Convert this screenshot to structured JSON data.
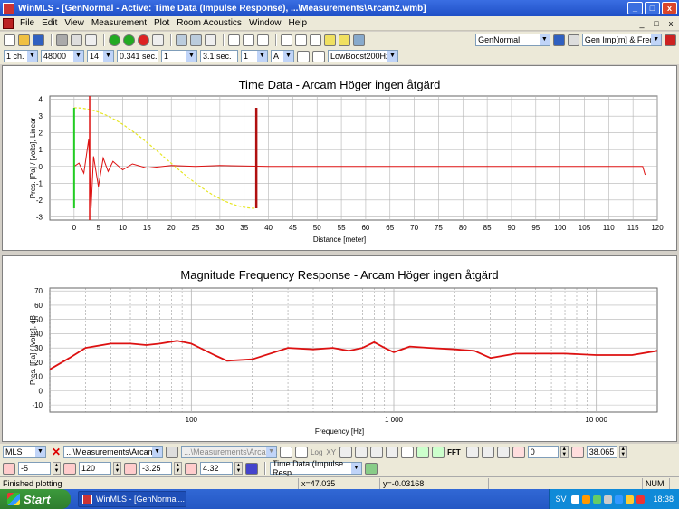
{
  "window": {
    "title": "WinMLS - [GenNormal - Active: Time Data (Impulse Response), ...\\Measurements\\Arcam2.wmb]",
    "min_label": "_",
    "max_label": "□",
    "close_label": "x"
  },
  "menu": [
    "File",
    "Edit",
    "View",
    "Measurement",
    "Plot",
    "Room Acoustics",
    "Window",
    "Help"
  ],
  "mdi_controls": [
    "_",
    "□",
    "x"
  ],
  "toolbar1": {
    "preset": "GenNormal",
    "graph_select": "Gen Imp[m] & Freq"
  },
  "toolbar2": {
    "channels": "1 ch.",
    "sample_rate": "48000",
    "order": "14",
    "length": "0.341 sec.",
    "averages": "1",
    "pre_delay": "3.1 sec.",
    "input": "1",
    "mode": "A",
    "filter": "LowBoost200HzS"
  },
  "colors": {
    "trace": "#dd1111",
    "window": "#e6e620",
    "green_marker": "#22cc22",
    "grid": "#b4b4b4"
  },
  "charts": [
    {
      "title": "Time Data - Arcam Höger ingen åtgärd",
      "ylabel": "Pres. [Pa] / [volts], Linear",
      "xlabel": "Distance [meter]",
      "xticks": [
        "0",
        "5",
        "10",
        "15",
        "20",
        "25",
        "30",
        "35",
        "40",
        "45",
        "50",
        "55",
        "60",
        "65",
        "70",
        "75",
        "80",
        "85",
        "90",
        "95",
        "100",
        "105",
        "110",
        "115",
        "120"
      ],
      "yticks": [
        "4",
        "3",
        "2",
        "1",
        "0",
        "-1",
        "-2",
        "-3"
      ]
    },
    {
      "title": "Magnitude Frequency Response - Arcam Höger ingen åtgärd",
      "ylabel": "Pres. [Pa] / [volts], dB",
      "xlabel": "Frequency [Hz]",
      "xticks": [
        "100",
        "1 000",
        "10 000"
      ],
      "yticks": [
        "70",
        "60",
        "50",
        "40",
        "30",
        "20",
        "10",
        "0",
        "-10"
      ]
    }
  ],
  "chart_data": [
    {
      "type": "line",
      "title": "Time Data - Arcam Höger ingen åtgärd",
      "xlabel": "Distance [meter]",
      "ylabel": "Pres. [Pa] / [volts], Linear",
      "xlim": [
        -5,
        120
      ],
      "ylim": [
        -3.2,
        4.2
      ],
      "grid": true,
      "markers_x": [
        0,
        3.2,
        37.5
      ],
      "x": [
        0,
        1,
        2,
        3,
        3.5,
        4,
        5,
        6,
        7,
        8,
        10,
        12,
        15,
        20,
        25,
        30,
        40,
        50,
        60,
        70,
        80,
        90,
        100,
        110,
        117,
        117.5
      ],
      "y": [
        0,
        0.2,
        -0.4,
        1.6,
        -2.5,
        0.6,
        -1.2,
        0.5,
        -0.3,
        0.3,
        -0.2,
        0.15,
        -0.1,
        0.05,
        0,
        0.05,
        0,
        0,
        0,
        0,
        0,
        0,
        0,
        0,
        0,
        -0.5
      ]
    },
    {
      "type": "line",
      "title": "Magnitude Frequency Response - Arcam Höger ingen åtgärd",
      "xlabel": "Frequency [Hz]",
      "ylabel": "Pres. [Pa] / [volts], dB",
      "xscale": "log",
      "xlim": [
        20,
        20000
      ],
      "ylim": [
        -15,
        72
      ],
      "grid": true,
      "x": [
        20,
        25,
        30,
        40,
        50,
        60,
        70,
        85,
        100,
        130,
        150,
        200,
        300,
        400,
        500,
        600,
        700,
        800,
        900,
        1000,
        1200,
        1500,
        2000,
        2500,
        3000,
        4000,
        5000,
        7000,
        10000,
        15000,
        20000
      ],
      "y": [
        15,
        23,
        30,
        33,
        33,
        32,
        33,
        35,
        33,
        25,
        21,
        22,
        30,
        29,
        30,
        28,
        30,
        34,
        30,
        27,
        31,
        30,
        29,
        28,
        23,
        26,
        26,
        26,
        25,
        25,
        28
      ]
    }
  ],
  "bottom1": {
    "type": "MLS",
    "file_a": "...\\Measurements\\Arcam2",
    "file_b": "...\\Measurements\\Arcam2",
    "log_label": "Log",
    "xy_label": "XY",
    "fft_label": "FFT",
    "start": "0",
    "end": "38.065"
  },
  "bottom2": {
    "ymin": "-5",
    "ymax": "120",
    "ylow": "-3.25",
    "yhigh": "4.32",
    "view": "Time Data (Impulse Resp"
  },
  "status": {
    "text": "Finished plotting",
    "x": "x=47.035",
    "y": "y=-0.03168",
    "num": "NUM"
  },
  "taskbar": {
    "start": "Start",
    "task": "WinMLS - [GenNormal...",
    "lang": "SV",
    "clock": "18:38"
  }
}
